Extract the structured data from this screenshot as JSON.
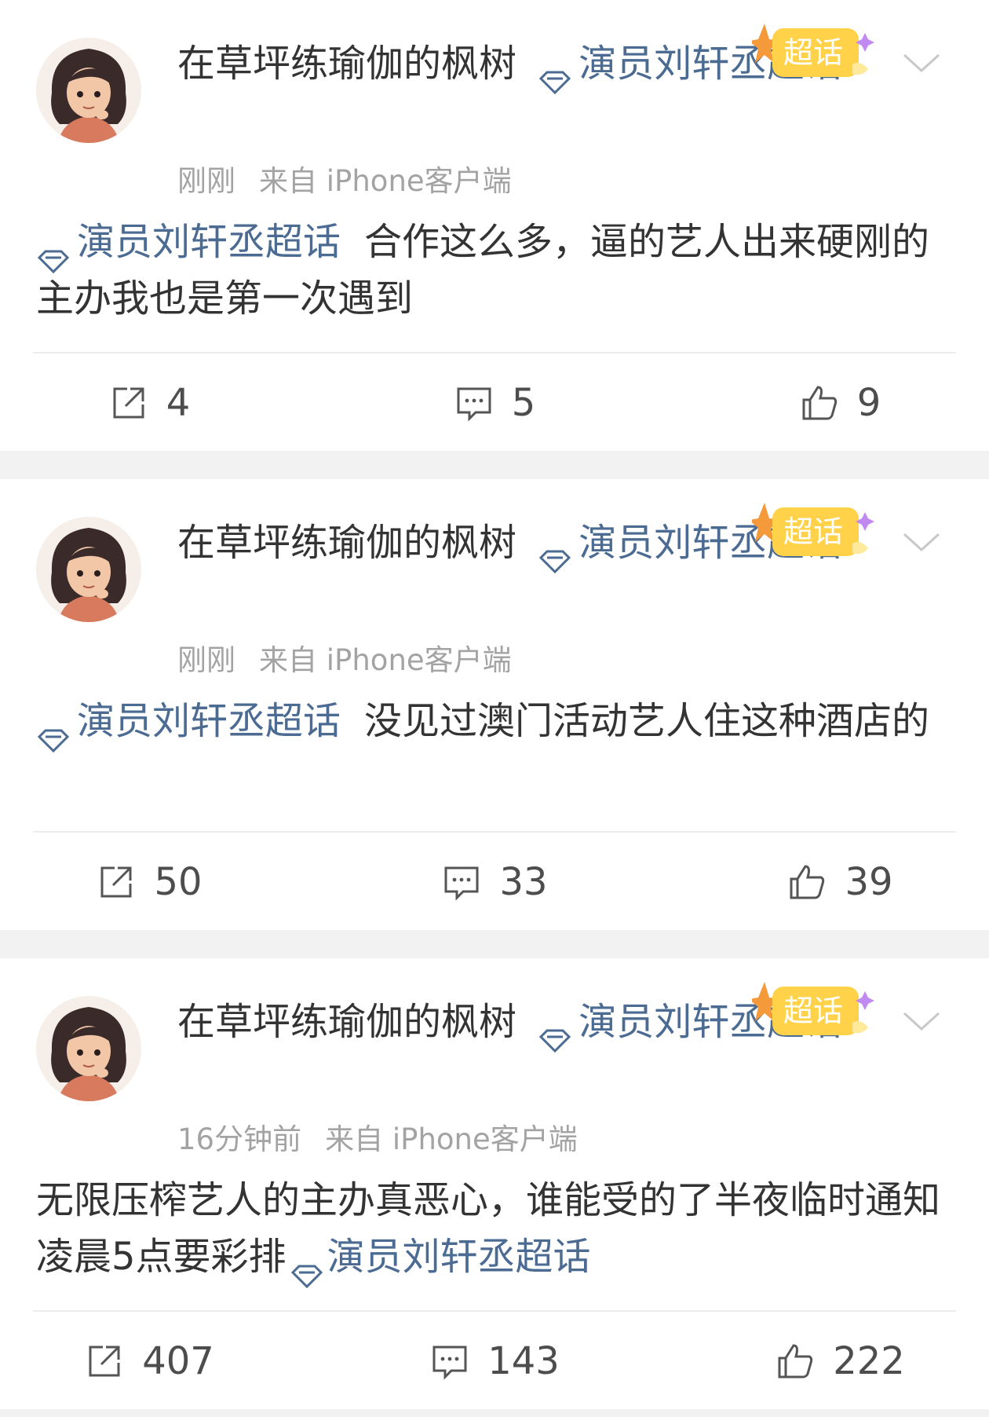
{
  "posts": [
    {
      "username": "在草坪练瑜伽的枫树",
      "topic": "演员刘轩丞超话",
      "badge": "超话",
      "time": "刚刚",
      "source": "来自 iPhone客户端",
      "tag": "演员刘轩丞超话",
      "text": "合作这么多，逼的艺人出来硬刚的主办我也是第一次遇到",
      "text_after": "",
      "shares": "4",
      "comments": "5",
      "likes": "9"
    },
    {
      "username": "在草坪练瑜伽的枫树",
      "topic": "演员刘轩丞超话",
      "badge": "超话",
      "time": "刚刚",
      "source": "来自 iPhone客户端",
      "tag": "演员刘轩丞超话",
      "text": "没见过澳门活动艺人住这种酒店的",
      "text_after": "",
      "shares": "50",
      "comments": "33",
      "likes": "39"
    },
    {
      "username": "在草坪练瑜伽的枫树",
      "topic": "演员刘轩丞超话",
      "badge": "超话",
      "time": "16分钟前",
      "source": "来自 iPhone客户端",
      "tag": "演员刘轩丞超话",
      "text": "无限压榨艺人的主办真恶心，谁能受的了半夜临时通知凌晨5点要彩排",
      "text_after": "",
      "shares": "407",
      "comments": "143",
      "likes": "222"
    }
  ],
  "colors": {
    "topic": "#4b6b92",
    "meta": "#a3a3a3",
    "text": "#333333",
    "separator": "#f2f2f2",
    "badge": "#ffd24a"
  },
  "icons": [
    "avatar-illustration",
    "diamond-icon",
    "super-topic-badge",
    "chevron-down-icon",
    "share-icon",
    "comment-icon",
    "like-icon"
  ]
}
